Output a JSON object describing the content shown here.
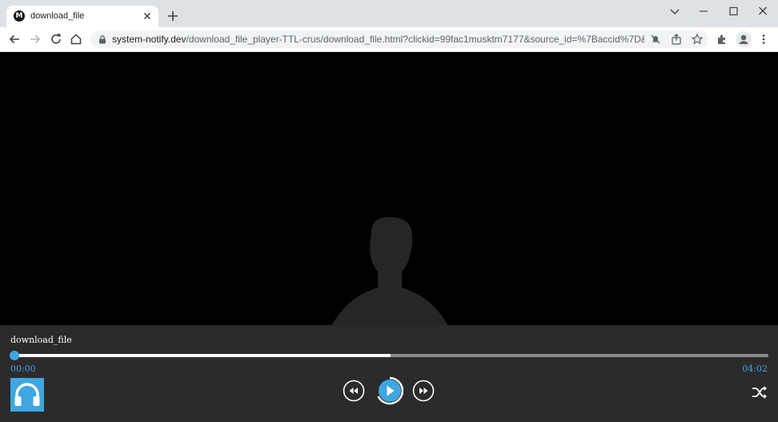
{
  "browser": {
    "tab_title": "download_file",
    "favicon_letter": "M",
    "url_host": "system-notify.dev",
    "url_path": "/download_file_player-TTL-crus/download_file.html?clickid=99fac1musktm7177&source_id=%7Baccid%7D&srczon..."
  },
  "player": {
    "track_title": "download_file",
    "time_current": "00:00",
    "time_total": "04:02",
    "buffered_fraction": 0.5,
    "accent_color": "#3ea6e0"
  }
}
